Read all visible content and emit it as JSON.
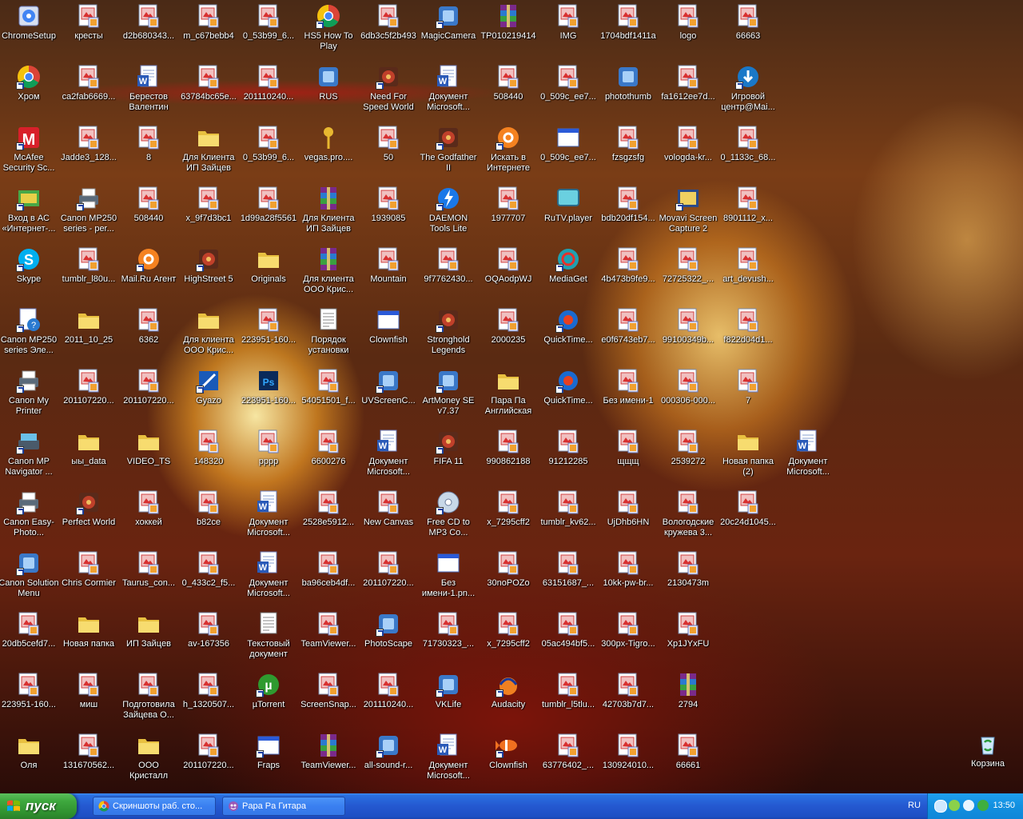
{
  "taskbar": {
    "start_label": "пуск",
    "tasks": [
      {
        "label": "Скриншоты раб. сто...",
        "icon": "chrome-icon"
      },
      {
        "label": "Paрa Pa Гитара",
        "icon": "game-icon"
      }
    ],
    "language": "RU",
    "clock": "13:50",
    "colors": {
      "taskbar": "#2458d0",
      "start": "#3ea83e",
      "tray": "#1290e0"
    }
  },
  "icons": [
    [
      {
        "label": "ChromeSetup",
        "type": "setup"
      },
      {
        "label": "Хром",
        "type": "chrome",
        "shortcut": true
      },
      {
        "label": "McAfee Security Sc...",
        "type": "mcafee",
        "shortcut": true
      },
      {
        "label": "Вход в АС «Интернет-...",
        "type": "bank",
        "shortcut": true
      },
      {
        "label": "Skype",
        "type": "skype",
        "shortcut": true
      },
      {
        "label": "Canon MP250 series Эле...",
        "type": "doc-help",
        "shortcut": true
      },
      {
        "label": "Canon My Printer",
        "type": "printer",
        "shortcut": true
      },
      {
        "label": "Canon MP Navigator ...",
        "type": "scanner",
        "shortcut": true
      },
      {
        "label": "Canon Easy-Photo...",
        "type": "printer",
        "shortcut": true
      },
      {
        "label": "Canon Solution Menu",
        "type": "app",
        "shortcut": true
      },
      {
        "label": "20db5cefd7...",
        "type": "image"
      },
      {
        "label": "223951-160...",
        "type": "image"
      },
      {
        "label": "Оля",
        "type": "folder"
      }
    ],
    [
      {
        "label": "кресты",
        "type": "image"
      },
      {
        "label": "ca2fab6669...",
        "type": "image"
      },
      {
        "label": "Jadde3_128...",
        "type": "image"
      },
      {
        "label": "Canon MP250 series - per...",
        "type": "printer",
        "shortcut": true
      },
      {
        "label": "tumblr_l80u...",
        "type": "image"
      },
      {
        "label": "2011_10_25",
        "type": "folder"
      },
      {
        "label": "201107220...",
        "type": "image"
      },
      {
        "label": "ыы_data",
        "type": "folder"
      },
      {
        "label": "Perfect World",
        "type": "game",
        "shortcut": true
      },
      {
        "label": "Chris Cormier",
        "type": "image"
      },
      {
        "label": "Новая папка",
        "type": "folder"
      },
      {
        "label": "миш",
        "type": "image"
      },
      {
        "label": "131670562...",
        "type": "image"
      }
    ],
    [
      {
        "label": "d2b680343...",
        "type": "image"
      },
      {
        "label": "Берестов Валентин",
        "type": "word"
      },
      {
        "label": "8",
        "type": "image"
      },
      {
        "label": "508440",
        "type": "image"
      },
      {
        "label": "Mail.Ru Агент",
        "type": "mailru",
        "shortcut": true
      },
      {
        "label": "6362",
        "type": "image"
      },
      {
        "label": "201107220...",
        "type": "image"
      },
      {
        "label": "VIDEO_TS",
        "type": "folder"
      },
      {
        "label": "хоккей",
        "type": "image"
      },
      {
        "label": "Taurus_con...",
        "type": "image"
      },
      {
        "label": "ИП Зайцев",
        "type": "folder"
      },
      {
        "label": "Подготовила Зайцева О...",
        "type": "image"
      },
      {
        "label": "ООО Кристалл",
        "type": "folder"
      }
    ],
    [
      {
        "label": "m_c67bebb4",
        "type": "image"
      },
      {
        "label": "63784bc65e...",
        "type": "image"
      },
      {
        "label": "Для Клиента ИП Зайцев",
        "type": "folder"
      },
      {
        "label": "x_9f7d3bc1",
        "type": "image"
      },
      {
        "label": "HighStreet 5",
        "type": "game",
        "shortcut": true
      },
      {
        "label": "Для клиента ООО Крис...",
        "type": "folder"
      },
      {
        "label": "Gyazo",
        "type": "gyazo",
        "shortcut": true
      },
      {
        "label": "148320",
        "type": "image"
      },
      {
        "label": "b82ce",
        "type": "image"
      },
      {
        "label": "0_433c2_f5...",
        "type": "image"
      },
      {
        "label": "av-167356",
        "type": "image"
      },
      {
        "label": "h_1320507...",
        "type": "image"
      },
      {
        "label": "201107220...",
        "type": "image"
      }
    ],
    [
      {
        "label": "0_53b99_6...",
        "type": "image"
      },
      {
        "label": "201110240...",
        "type": "image"
      },
      {
        "label": "0_53b99_6...",
        "type": "image"
      },
      {
        "label": "1d99a28f5561",
        "type": "image"
      },
      {
        "label": "Originals",
        "type": "folder"
      },
      {
        "label": "223951-160...",
        "type": "image"
      },
      {
        "label": "223951-160...",
        "type": "psd"
      },
      {
        "label": "pppp",
        "type": "image"
      },
      {
        "label": "Документ Microsoft...",
        "type": "word"
      },
      {
        "label": "Документ Microsoft...",
        "type": "word"
      },
      {
        "label": "Текстовый документ",
        "type": "text"
      },
      {
        "label": "µTorrent",
        "type": "utorrent",
        "shortcut": true
      },
      {
        "label": "Fraps",
        "type": "window",
        "shortcut": true
      }
    ],
    [
      {
        "label": "HS5 How To Play",
        "type": "chrome",
        "shortcut": true
      },
      {
        "label": "RUS",
        "type": "app"
      },
      {
        "label": "vegas.pro....",
        "type": "key"
      },
      {
        "label": "Для Клиента ИП Зайцев",
        "type": "archive"
      },
      {
        "label": "Для клиента ООО Крис...",
        "type": "archive"
      },
      {
        "label": "Порядок установки",
        "type": "text"
      },
      {
        "label": "54051501_f...",
        "type": "image"
      },
      {
        "label": "6600276",
        "type": "image"
      },
      {
        "label": "2528e5912...",
        "type": "image"
      },
      {
        "label": "ba96ceb4df...",
        "type": "image"
      },
      {
        "label": "TeamViewer...",
        "type": "image"
      },
      {
        "label": "ScreenSnap...",
        "type": "image"
      },
      {
        "label": "TeamViewer...",
        "type": "archive"
      }
    ],
    [
      {
        "label": "6db3c5f2b493",
        "type": "image"
      },
      {
        "label": "Need For Speed World",
        "type": "game",
        "shortcut": true
      },
      {
        "label": "50",
        "type": "image"
      },
      {
        "label": "1939085",
        "type": "image"
      },
      {
        "label": "Mountain",
        "type": "image"
      },
      {
        "label": "Clownfish",
        "type": "window"
      },
      {
        "label": "UVScreenC...",
        "type": "app",
        "shortcut": true
      },
      {
        "label": "Документ Microsoft...",
        "type": "word"
      },
      {
        "label": "New Canvas",
        "type": "image"
      },
      {
        "label": "201107220...",
        "type": "image"
      },
      {
        "label": "PhotoScape",
        "type": "app",
        "shortcut": true
      },
      {
        "label": "201110240...",
        "type": "image"
      },
      {
        "label": "all-sound-r...",
        "type": "app",
        "shortcut": true
      }
    ],
    [
      {
        "label": "MagicCamera",
        "type": "app",
        "shortcut": true
      },
      {
        "label": "Документ Microsoft...",
        "type": "word"
      },
      {
        "label": "The Godfather II",
        "type": "game",
        "shortcut": true
      },
      {
        "label": "DAEMON Tools Lite",
        "type": "daemon",
        "shortcut": true
      },
      {
        "label": "9f7762430...",
        "type": "image"
      },
      {
        "label": "Stronghold Legends",
        "type": "game",
        "shortcut": true
      },
      {
        "label": "ArtMoney SE v7.37",
        "type": "app",
        "shortcut": true
      },
      {
        "label": "FIFA 11",
        "type": "game",
        "shortcut": true
      },
      {
        "label": "Free CD to MP3 Co...",
        "type": "cd",
        "shortcut": true
      },
      {
        "label": "Без имени-1.pn...",
        "type": "window"
      },
      {
        "label": "71730323_...",
        "type": "image"
      },
      {
        "label": "VKLife",
        "type": "app",
        "shortcut": true
      },
      {
        "label": "Документ Microsoft...",
        "type": "word"
      }
    ],
    [
      {
        "label": "TP010219414",
        "type": "archive"
      },
      {
        "label": "508440",
        "type": "image"
      },
      {
        "label": "Искать в Интернете",
        "type": "mailru",
        "shortcut": true
      },
      {
        "label": "1977707",
        "type": "image"
      },
      {
        "label": "OQAodpWJ",
        "type": "image"
      },
      {
        "label": "2000235",
        "type": "image"
      },
      {
        "label": "Пара Па Английская",
        "type": "folder"
      },
      {
        "label": "990862188",
        "type": "image"
      },
      {
        "label": "x_7295cff2",
        "type": "image"
      },
      {
        "label": "30noPOZo",
        "type": "image"
      },
      {
        "label": "x_7295cff2",
        "type": "image"
      },
      {
        "label": "Audacity",
        "type": "audacity",
        "shortcut": true
      },
      {
        "label": "Clownfish",
        "type": "fish",
        "shortcut": true
      }
    ],
    [
      {
        "label": "IMG",
        "type": "image"
      },
      {
        "label": "0_509c_ee7...",
        "type": "image"
      },
      {
        "label": "0_509c_ee7...",
        "type": "window"
      },
      {
        "label": "RuTV.player",
        "type": "tv"
      },
      {
        "label": "MediaGet",
        "type": "mediaget",
        "shortcut": true
      },
      {
        "label": "QuickTime...",
        "type": "quicktime",
        "shortcut": true
      },
      {
        "label": "QuickTime...",
        "type": "quicktime",
        "shortcut": true
      },
      {
        "label": "91212285",
        "type": "image"
      },
      {
        "label": "tumblr_kv62...",
        "type": "image"
      },
      {
        "label": "63151687_...",
        "type": "image"
      },
      {
        "label": "05ac494bf5...",
        "type": "image"
      },
      {
        "label": "tumblr_l5tlu...",
        "type": "image"
      },
      {
        "label": "63776402_...",
        "type": "image"
      }
    ],
    [
      {
        "label": "1704bdf1411a",
        "type": "image"
      },
      {
        "label": "photothumb",
        "type": "app"
      },
      {
        "label": "fzsgzsfg",
        "type": "image"
      },
      {
        "label": "bdb20df154...",
        "type": "image"
      },
      {
        "label": "4b473b9fe9...",
        "type": "image"
      },
      {
        "label": "e0f6743eb7...",
        "type": "image"
      },
      {
        "label": "Без имени-1",
        "type": "image"
      },
      {
        "label": "щщщ",
        "type": "image"
      },
      {
        "label": "UjDhb6HN",
        "type": "image"
      },
      {
        "label": "10kk-pw-br...",
        "type": "image"
      },
      {
        "label": "300px-Tigro...",
        "type": "image"
      },
      {
        "label": "42703b7d7...",
        "type": "image"
      },
      {
        "label": "130924010...",
        "type": "image"
      }
    ],
    [
      {
        "label": "logo",
        "type": "image"
      },
      {
        "label": "fa1612ee7d...",
        "type": "image"
      },
      {
        "label": "vologda-kr...",
        "type": "image"
      },
      {
        "label": "Movavi Screen Capture 2",
        "type": "movavi",
        "shortcut": true
      },
      {
        "label": "72725322_...",
        "type": "image"
      },
      {
        "label": "99100349b...",
        "type": "image"
      },
      {
        "label": "000306-000...",
        "type": "image"
      },
      {
        "label": "2539272",
        "type": "image"
      },
      {
        "label": "Вологодские кружева 3...",
        "type": "image"
      },
      {
        "label": "2130473m",
        "type": "image"
      },
      {
        "label": "Xp1JYxFU",
        "type": "image"
      },
      {
        "label": "2794",
        "type": "archive"
      },
      {
        "label": "66661",
        "type": "image"
      }
    ],
    [
      {
        "label": "66663",
        "type": "image"
      },
      {
        "label": "Игровой центр@Mai...",
        "type": "gamecenter",
        "shortcut": true
      },
      {
        "label": "0_1133c_68...",
        "type": "image"
      },
      {
        "label": "8901112_x...",
        "type": "image"
      },
      {
        "label": "art_devush...",
        "type": "image"
      },
      {
        "label": "f822d04d1...",
        "type": "image"
      },
      {
        "label": "7",
        "type": "image"
      },
      {
        "label": "Новая папка (2)",
        "type": "folder"
      },
      {
        "label": "20c24d1045...",
        "type": "image"
      }
    ],
    [
      {
        "label": "",
        "type": "none"
      },
      {
        "label": "",
        "type": "none"
      },
      {
        "label": "",
        "type": "none"
      },
      {
        "label": "",
        "type": "none"
      },
      {
        "label": "",
        "type": "none"
      },
      {
        "label": "",
        "type": "none"
      },
      {
        "label": "",
        "type": "none"
      },
      {
        "label": "Документ Microsoft...",
        "type": "word"
      }
    ]
  ],
  "recycle_bin": {
    "label": "Корзина",
    "type": "recycle"
  }
}
